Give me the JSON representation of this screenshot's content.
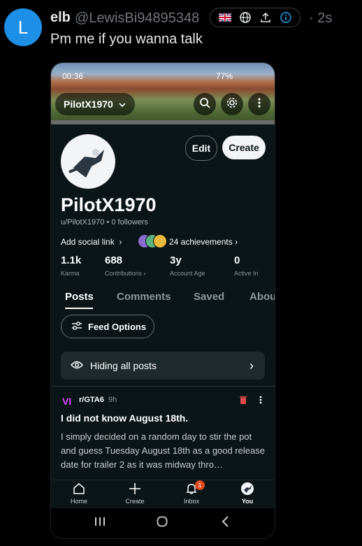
{
  "tweet": {
    "avatar_letter": "L",
    "author": "elb",
    "handle": "@LewisBi94895348",
    "time_ago": "· 2s",
    "text": "Pm me if you wanna talk",
    "badges": [
      "flag-uk-icon",
      "globe-icon",
      "share-icon",
      "info-icon"
    ]
  },
  "phone": {
    "status_time": "00:36",
    "battery": "77%",
    "username_pill": "PilotX1970",
    "buttons": {
      "edit": "Edit",
      "create": "Create"
    },
    "name": "PilotX1970",
    "subline": "u/PilotX1970 • 0 followers",
    "add_social": "Add social link",
    "achievements": "24 achievements",
    "stats": [
      {
        "value": "1.1k",
        "label": "Karma"
      },
      {
        "value": "688",
        "label": "Contributions"
      },
      {
        "value": "3y",
        "label": "Account Age"
      },
      {
        "value": "0",
        "label": "Active In"
      }
    ],
    "tabs": [
      "Posts",
      "Comments",
      "Saved",
      "Abou"
    ],
    "feed_options": "Feed Options",
    "hiding": "Hiding all posts",
    "post": {
      "subreddit": "r/GTA6",
      "time": "9h",
      "title": "I did not know August 18th.",
      "body": "I simply decided on a random day to stir the pot and guess Tuesday August 18th as a good release date for trailer 2 as it was midway thro…"
    },
    "nav": [
      {
        "label": "Home",
        "icon": "home-icon"
      },
      {
        "label": "Create",
        "icon": "plus-icon"
      },
      {
        "label": "Inbox",
        "icon": "bell-icon"
      },
      {
        "label": "You",
        "icon": "avatar-icon"
      }
    ],
    "inbox_badge": "1"
  }
}
